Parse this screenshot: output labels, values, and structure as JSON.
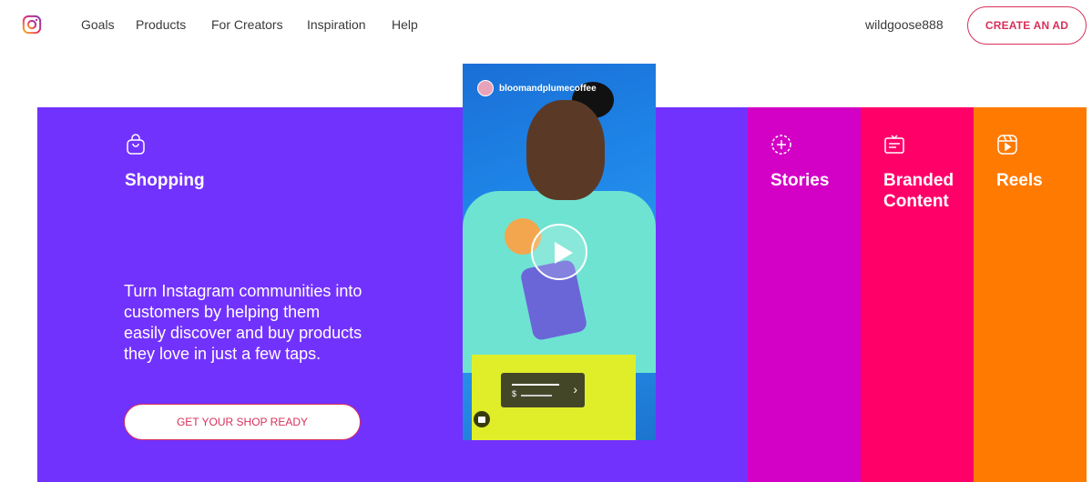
{
  "nav": {
    "logo_icon": "instagram-logo-icon",
    "items": [
      {
        "label": "Goals"
      },
      {
        "label": "Products"
      },
      {
        "label": "For Creators"
      },
      {
        "label": "Inspiration"
      },
      {
        "label": "Help"
      }
    ],
    "username": "wildgoose888",
    "create_ad_label": "CREATE AN AD"
  },
  "colors": {
    "shopping": "#7232fe",
    "stories": "#d300c5",
    "branded": "#ff0069",
    "reels": "#ff7a00",
    "accent": "#d8305a"
  },
  "panels": {
    "shopping": {
      "icon": "shopping-bag-icon",
      "title": "Shopping",
      "description": "Turn Instagram communities into customers by helping them easily discover and buy products they love in just a few taps.",
      "button_label": "GET YOUR SHOP READY"
    },
    "stories": {
      "icon": "stories-plus-icon",
      "title": "Stories"
    },
    "branded": {
      "icon": "branded-content-icon",
      "title": "Branded Content"
    },
    "reels": {
      "icon": "reels-icon",
      "title": "Reels"
    }
  },
  "video": {
    "account_name": "bloomandplumecoffee",
    "price_symbol": "$",
    "play_icon": "play-icon"
  }
}
